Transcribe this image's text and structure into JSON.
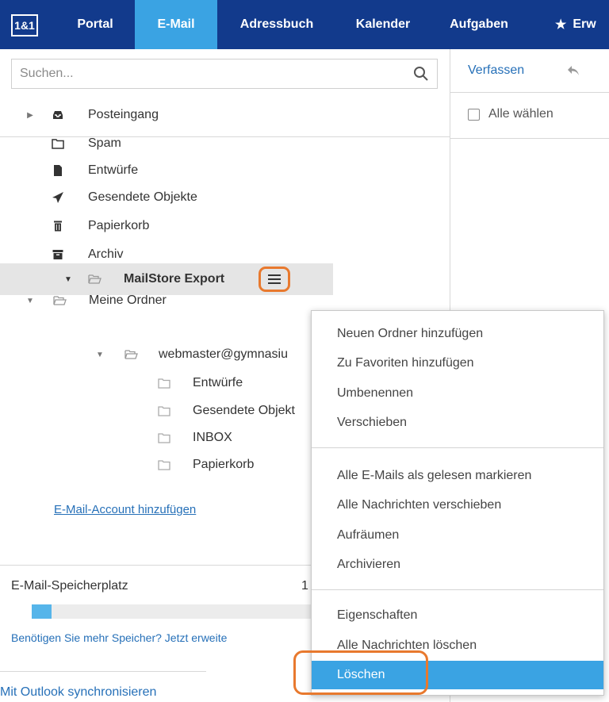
{
  "nav": {
    "logo": "1&1",
    "tabs": [
      {
        "label": "Portal"
      },
      {
        "label": "E-Mail"
      },
      {
        "label": "Adressbuch"
      },
      {
        "label": "Kalender"
      },
      {
        "label": "Aufgaben"
      },
      {
        "label": "Erw"
      }
    ]
  },
  "search": {
    "placeholder": "Suchen..."
  },
  "folders": {
    "inbox": "Posteingang",
    "spam": "Spam",
    "drafts": "Entwürfe",
    "sent": "Gesendete Objekte",
    "trash": "Papierkorb",
    "archive": "Archiv",
    "my_folders": "Meine Ordner",
    "mailstore": "MailStore Export",
    "account": "webmaster@gymnasiu",
    "sub_drafts": "Entwürfe",
    "sub_sent": "Gesendete Objekt",
    "sub_inbox": "INBOX",
    "sub_trash": "Papierkorb"
  },
  "add_account": "E-Mail-Account hinzufügen",
  "storage": {
    "label": "E-Mail-Speicherplatz",
    "value": "1",
    "fill_percent": 7,
    "upgrade": "Benötigen Sie mehr Speicher? Jetzt erweite",
    "sync": "Mit Outlook synchronisieren"
  },
  "right": {
    "compose": "Verfassen",
    "select_all": "Alle wählen"
  },
  "context_menu": {
    "group1": [
      "Neuen Ordner hinzufügen",
      "Zu Favoriten hinzufügen",
      "Umbenennen",
      "Verschieben"
    ],
    "group2": [
      "Alle E-Mails als gelesen markieren",
      "Alle Nachrichten verschieben",
      "Aufräumen",
      "Archivieren"
    ],
    "group3": [
      "Eigenschaften",
      "Alle Nachrichten löschen",
      "Löschen"
    ]
  },
  "colors": {
    "nav_bg": "#123a8c",
    "accent": "#3aa3e3",
    "highlight_ring": "#e8792e"
  }
}
